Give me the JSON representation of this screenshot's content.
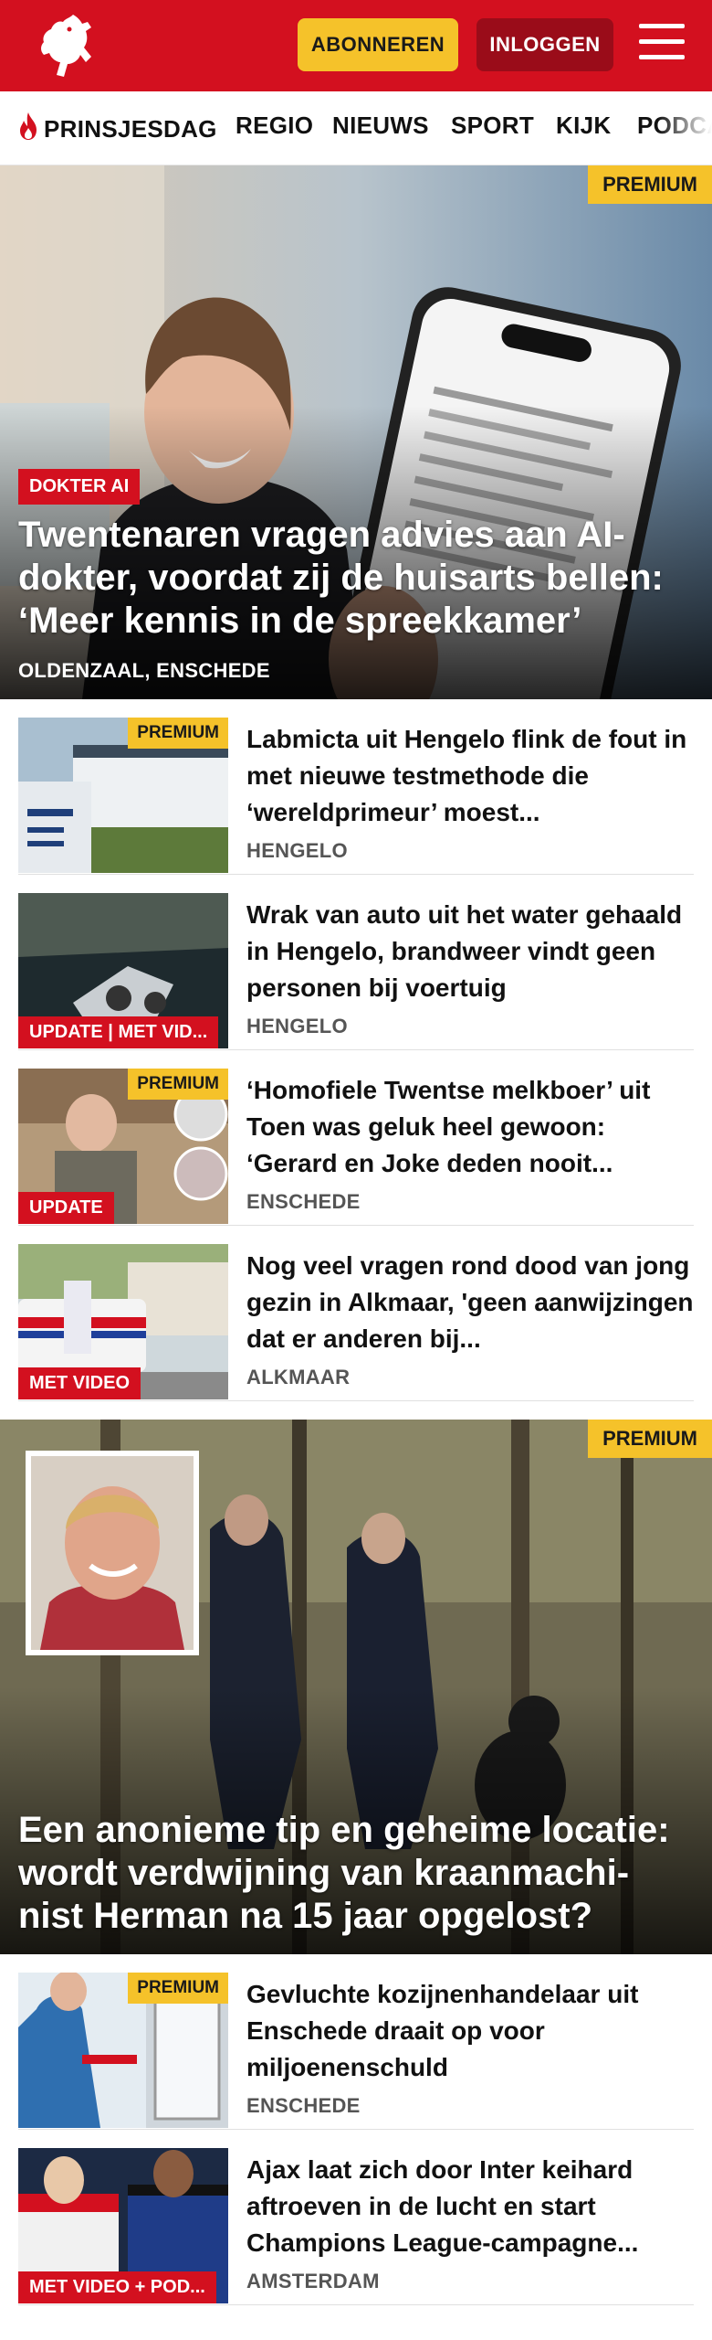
{
  "header": {
    "subscribe_label": "ABONNEREN",
    "login_label": "INLOGGEN"
  },
  "nav": {
    "items": [
      "PRINSJESDAG",
      "REGIO",
      "NIEUWS",
      "SPORT",
      "KIJK",
      "PODCA"
    ]
  },
  "hero": {
    "premium": "PREMIUM",
    "tag": "DOKTER AI",
    "title": "Twentenaren vragen advies aan AI-dokter, voordat zij de huisarts bellen: ‘Meer kennis in de spreekkamer’",
    "location": "OLDENZAAL, ENSCHEDE"
  },
  "articles": [
    {
      "premium": "PREMIUM",
      "tag": "",
      "title": "Labmicta uit Hengelo flink de fout in met nieuwe testmethode die ‘wereldprimeur’ moest...",
      "location": "HENGELO"
    },
    {
      "premium": "",
      "tag": "UPDATE | MET VID...",
      "title": "Wrak van auto uit het water gehaald in Hengelo, brandweer vindt geen personen bij voertuig",
      "location": "HENGELO"
    },
    {
      "premium": "PREMIUM",
      "tag": "UPDATE",
      "title": "‘Homofiele Twentse melkboer’ uit Toen was geluk heel gewoon: ‘Gerard en Joke deden nooit...",
      "location": "ENSCHEDE"
    },
    {
      "premium": "",
      "tag": "MET VIDEO",
      "title": "Nog veel vragen rond dood van jong gezin in Alkmaar, 'geen aanwijzingen dat er anderen bij...",
      "location": "ALKMAAR"
    }
  ],
  "hero2": {
    "premium": "PREMIUM",
    "title": "Een anonieme tip en geheime locatie: wordt verdwijning van kraanmachi-nist Herman na 15 jaar opgelost?"
  },
  "articles2": [
    {
      "premium": "PREMIUM",
      "tag": "",
      "title": "Gevluchte kozijnenhandelaar uit Enschede draait op voor miljoenenschuld",
      "location": "ENSCHEDE"
    },
    {
      "premium": "",
      "tag": "MET VIDEO + POD...",
      "title": "Ajax laat zich door Inter keihard aftroeven in de lucht en start Champions League-campagne...",
      "location": "AMSTERDAM"
    }
  ],
  "colors": {
    "brand_red": "#d3101f",
    "premium_yellow": "#f5c22a",
    "login_dark_red": "#9a0c19"
  }
}
